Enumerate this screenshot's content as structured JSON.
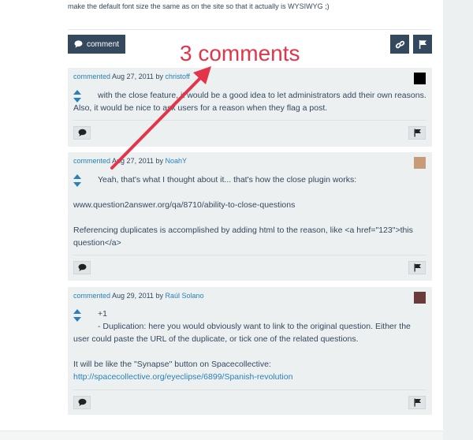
{
  "top_text": "make the default font size the same as on the site so that it actually is WYSIWYG ;)",
  "comment_button_label": "comment",
  "annotation": "3 comments",
  "comments": [
    {
      "action": "commented",
      "date": "Aug 27, 2011",
      "by": "by",
      "author": "christoff",
      "text": "with the close feature, it would be a good idea to let administrators add their own reasons. Also, it would be nice to ask users for a reason when they flag a post."
    },
    {
      "action": "commented",
      "date": "Aug 27, 2011",
      "by": "by",
      "author": "NoahY",
      "line1": "Yeah, that's what I thought about it... that's how the close plugin works:",
      "line2": "www.question2answer.org/qa/8710/ability-to-close-questions",
      "line3": "Referencing duplicates is accomplished by adding html to the reason, like <a href=\"123\">this question</a>"
    },
    {
      "action": "commented",
      "date": "Aug 29, 2011",
      "by": "by",
      "author": "Raúl Solano",
      "line1": "+1",
      "line2": "- Duplication: here you would obviously want to link to the original question. Either the user could paste the URL of the duplicate, or tick one of the related questions.",
      "line3": "It will be like the \"Synapse\" button on Spacecollective:",
      "link": "http://spacecollective.org/eyeclipse/6899/Spanish-revolution"
    }
  ],
  "colors": {
    "primary_dark": "#34495e",
    "link": "#2980b9",
    "comment_bg": "#ecf0f1",
    "annotation": "#e3344a"
  },
  "icons": [
    "comment-icon",
    "link-icon",
    "flag-icon",
    "vote-up-icon",
    "vote-down-icon"
  ]
}
